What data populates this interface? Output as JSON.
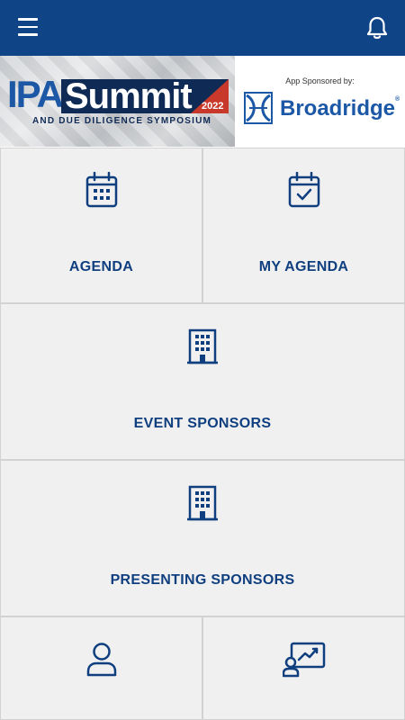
{
  "topbar": {
    "menu_icon": "hamburger-menu-icon",
    "notification_icon": "bell-icon",
    "color": "#0f4486"
  },
  "banner": {
    "logo_ipa": "IPA",
    "logo_summit": "Summit",
    "logo_year": "2022",
    "logo_subtitle": "AND DUE DILIGENCE SYMPOSIUM",
    "sponsor_caption": "App Sponsored by:",
    "sponsor_name": "Broadridge",
    "sponsor_reg": "®"
  },
  "tiles": [
    {
      "label": "AGENDA",
      "icon": "calendar-grid-icon"
    },
    {
      "label": "MY AGENDA",
      "icon": "calendar-check-icon"
    },
    {
      "label": "EVENT SPONSORS",
      "icon": "building-icon"
    },
    {
      "label": "PRESENTING SPONSORS",
      "icon": "building-icon"
    },
    {
      "label": "",
      "icon": "user-icon"
    },
    {
      "label": "",
      "icon": "presentation-chart-icon"
    }
  ],
  "colors": {
    "accent": "#103f80",
    "tile_bg": "#f0f0f0",
    "tile_border": "#d2d2d2"
  }
}
